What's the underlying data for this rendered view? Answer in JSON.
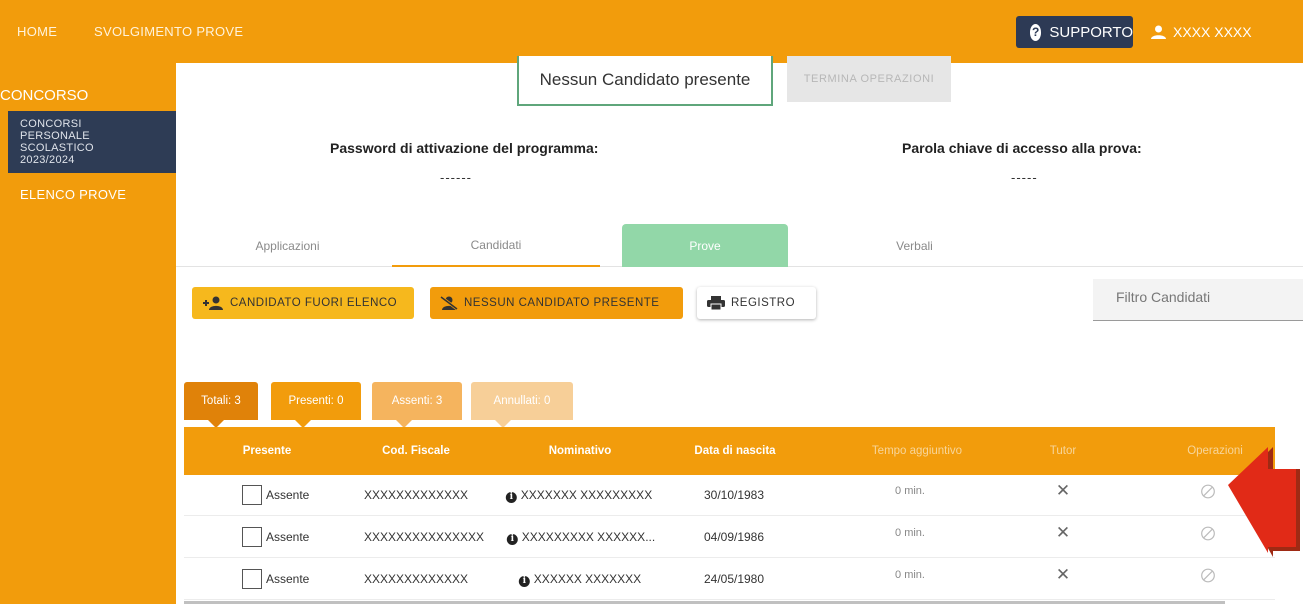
{
  "topnav": {
    "home": "HOME",
    "section": "SVOLGIMENTO PROVE",
    "support": "SUPPORTO",
    "user": "XXXX XXXX"
  },
  "sidebar": {
    "title": "CONCORSO",
    "active_lines": [
      "CONCORSI",
      "PERSONALE",
      "SCOLASTICO",
      "2023/2024"
    ],
    "item": "ELENCO PROVE"
  },
  "status": {
    "presence": "Nessun Candidato presente",
    "termina": "TERMINA OPERAZIONI"
  },
  "passwords": {
    "program_label": "Password di attivazione del programma:",
    "program_value": "------",
    "keyword_label": "Parola chiave di accesso alla prova:",
    "keyword_value": "-----"
  },
  "tabs": [
    "Applicazioni",
    "Candidati",
    "Prove",
    "Verbali"
  ],
  "actions": {
    "fuori_elenco": "CANDIDATO FUORI ELENCO",
    "nessuno": "NESSUN CANDIDATO PRESENTE",
    "registro": "REGISTRO"
  },
  "filter": {
    "placeholder": "Filtro Candidati"
  },
  "summary": [
    "Totali: 3",
    "Presenti: 0",
    "Assenti: 3",
    "Annullati: 0"
  ],
  "colors": {
    "orange": "#f29c0c",
    "navy": "#2d3a55",
    "green": "#92d7a8"
  },
  "table": {
    "headers": [
      "Presente",
      "Cod. Fiscale",
      "Nominativo",
      "Data di nascita",
      "Tempo aggiuntivo",
      "Tutor",
      "Operazioni"
    ],
    "rows": [
      {
        "status": "Assente",
        "cf": "XXXXXXXXXXXXX",
        "name": "XXXXXXX XXXXXXXXX",
        "dob": "30/10/1983",
        "tempo": "0 min.",
        "tutor": "✕",
        "ops": "⊘"
      },
      {
        "status": "Assente",
        "cf": "XXXXXXXXXXXXXXX",
        "name": "XXXXXXXXX XXXXXX...",
        "dob": "04/09/1986",
        "tempo": "0 min.",
        "tutor": "✕",
        "ops": "⊘"
      },
      {
        "status": "Assente",
        "cf": "XXXXXXXXXXXXX",
        "name": "XXXXXX XXXXXXX",
        "dob": "24/05/1980",
        "tempo": "0 min.",
        "tutor": "✕",
        "ops": "⊘"
      }
    ]
  }
}
